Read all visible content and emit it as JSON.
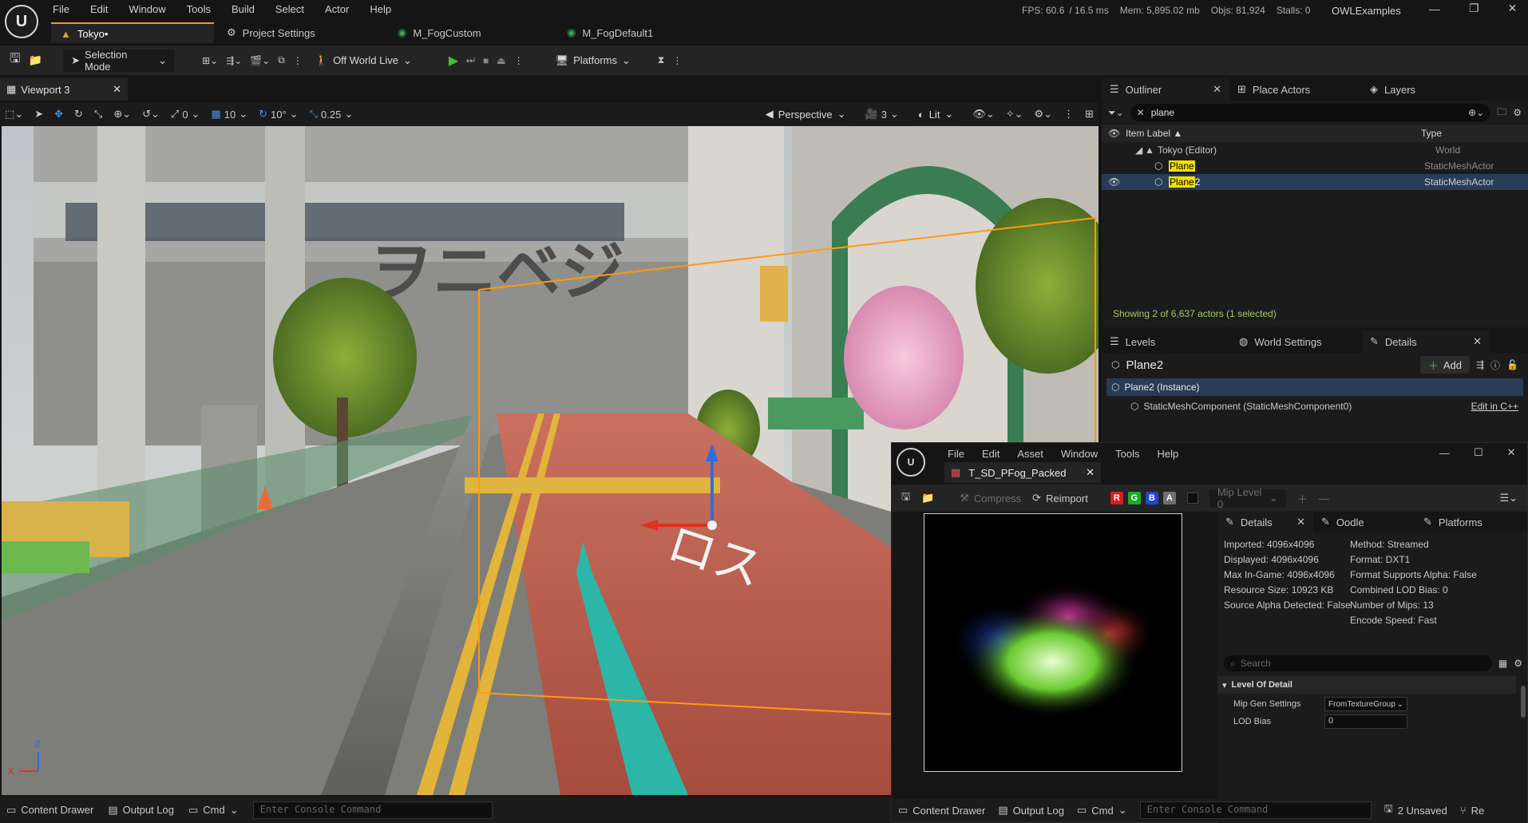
{
  "menu": [
    "File",
    "Edit",
    "Window",
    "Tools",
    "Build",
    "Select",
    "Actor",
    "Help"
  ],
  "stats": {
    "fps": "FPS: 60.6",
    "ms": "/ 16.5 ms",
    "mem": "Mem: 5,895.02 mb",
    "objs": "Objs: 81,924",
    "stalls": "Stalls: 0"
  },
  "project_name": "OWLExamples",
  "doc_tabs": [
    "Tokyo•",
    "Project Settings",
    "M_FogCustom",
    "M_FogDefault1"
  ],
  "toolbar": {
    "selection_mode": "Selection Mode",
    "world": "Off World Live",
    "platforms": "Platforms"
  },
  "viewport": {
    "tab_label": "Viewport 3",
    "rot": "0",
    "grid": "10",
    "angle": "10°",
    "scale": "0.25",
    "perspective": "Perspective",
    "speed": "3",
    "view_mode": "Lit",
    "axis_z": "Z",
    "axis_x": "X"
  },
  "outliner": {
    "tab": "Outliner",
    "place_actors": "Place Actors",
    "layers": "Layers",
    "search_value": "plane",
    "col_label": "Item Label ▲",
    "col_type": "Type",
    "rows": [
      {
        "label": "Tokyo (Editor)",
        "type": "World"
      },
      {
        "label_hl": "Plane",
        "label_rest": "",
        "type": "StaticMeshActor"
      },
      {
        "label_hl": "Plane",
        "label_rest": "2",
        "type": "StaticMeshActor"
      }
    ],
    "footer": "Showing 2 of 6,637 actors (1 selected)"
  },
  "details": {
    "tabs": [
      "Levels",
      "World Settings",
      "Details"
    ],
    "actor": "Plane2",
    "add": "Add",
    "instance": "Plane2 (Instance)",
    "component": "StaticMeshComponent (StaticMeshComponent0)",
    "edit_cpp": "Edit in C++"
  },
  "texture_editor": {
    "menu": [
      "File",
      "Edit",
      "Asset",
      "Window",
      "Tools",
      "Help"
    ],
    "tab": "T_SD_PFog_Packed",
    "compress": "Compress",
    "reimport": "Reimport",
    "channels": [
      "R",
      "G",
      "B",
      "A"
    ],
    "mip": "Mip Level 0",
    "panel_tabs": [
      "Details",
      "Oodle",
      "Platforms"
    ],
    "info_left": [
      "Imported: 4096x4096",
      "Displayed: 4096x4096",
      "Max In-Game: 4096x4096",
      "Resource Size: 10923 KB",
      "Source Alpha Detected: False"
    ],
    "info_right": [
      "Method: Streamed",
      "Format: DXT1",
      "Format Supports Alpha: False",
      "Combined LOD Bias: 0",
      "Number of Mips: 13",
      "Encode Speed: Fast"
    ],
    "search_placeholder": "Search",
    "section": "Level Of Detail",
    "mip_gen_label": "Mip Gen Settings",
    "mip_gen_value": "FromTextureGroup",
    "lod_bias_label": "LOD Bias",
    "lod_bias_value": "0"
  },
  "bottom": {
    "content_drawer": "Content Drawer",
    "output_log": "Output Log",
    "cmd": "Cmd",
    "console_placeholder": "Enter Console Command",
    "unsaved": "2 Unsaved",
    "revision": "Re"
  }
}
